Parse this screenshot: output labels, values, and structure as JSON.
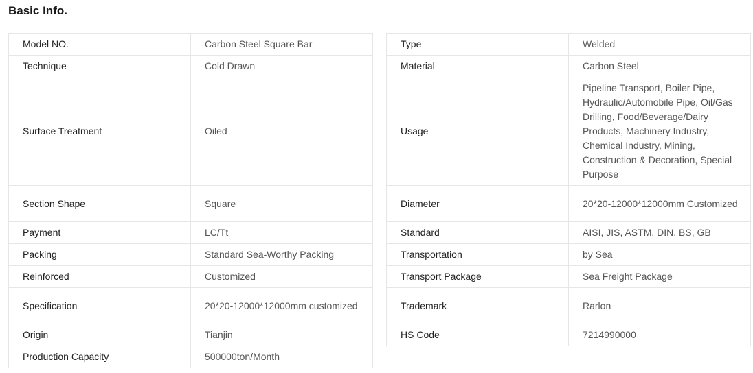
{
  "title": "Basic Info.",
  "left_rows": [
    {
      "key": "Model NO.",
      "value": "Carbon Steel Square Bar"
    },
    {
      "key": "Technique",
      "value": "Cold Drawn"
    },
    {
      "key": "Surface Treatment",
      "value": "Oiled"
    },
    {
      "key": "Section Shape",
      "value": "Square"
    },
    {
      "key": "Payment",
      "value": "LC/Tt"
    },
    {
      "key": "Packing",
      "value": "Standard Sea-Worthy Packing"
    },
    {
      "key": "Reinforced",
      "value": "Customized"
    },
    {
      "key": "Specification",
      "value": "20*20-12000*12000mm customized"
    },
    {
      "key": "Origin",
      "value": "Tianjin"
    },
    {
      "key": "Production Capacity",
      "value": "500000ton/Month"
    }
  ],
  "right_rows": [
    {
      "key": "Type",
      "value": "Welded"
    },
    {
      "key": "Material",
      "value": "Carbon Steel"
    },
    {
      "key": "Usage",
      "value": "Pipeline Transport, Boiler Pipe, Hydraulic/Automobile Pipe, Oil/Gas Drilling, Food/Beverage/Dairy Products, Machinery Industry, Chemical Industry, Mining, Construction & Decoration, Special Purpose"
    },
    {
      "key": "Diameter",
      "value": "20*20-12000*12000mm Customized"
    },
    {
      "key": "Standard",
      "value": "AISI, JIS, ASTM, DIN, BS, GB"
    },
    {
      "key": "Transportation",
      "value": "by Sea"
    },
    {
      "key": "Transport Package",
      "value": "Sea Freight Package"
    },
    {
      "key": "Trademark",
      "value": "Rarlon"
    },
    {
      "key": "HS Code",
      "value": "7214990000"
    }
  ]
}
